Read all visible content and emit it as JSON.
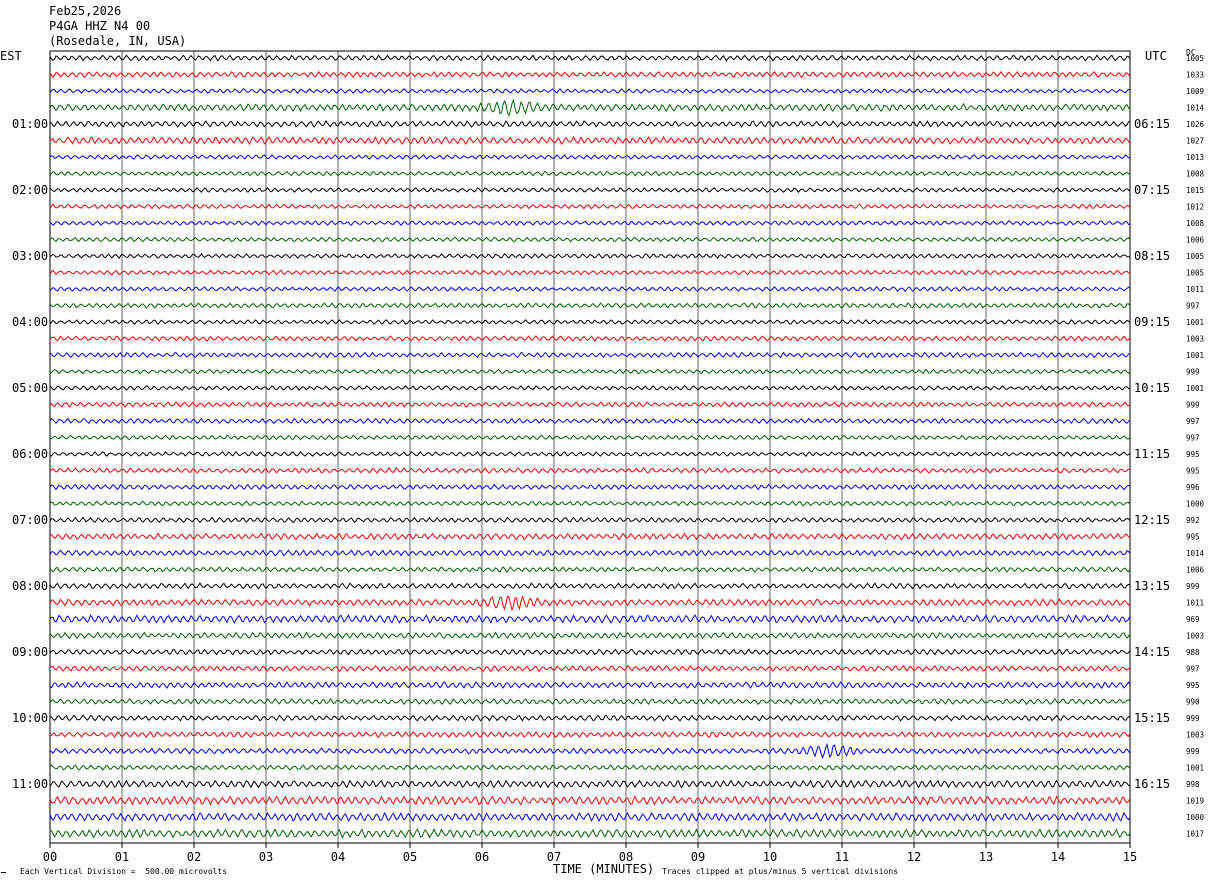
{
  "header": {
    "date": "Feb25,2026",
    "station": "P4GA HHZ N4 00",
    "location": "(Rosedale, IN, USA)"
  },
  "left_timezone": "EST",
  "right_timezone": "UTC",
  "right_col_header": "DC",
  "xaxis": {
    "label": "TIME (MINUTES)",
    "ticks": [
      "00",
      "01",
      "02",
      "03",
      "04",
      "05",
      "06",
      "07",
      "08",
      "09",
      "10",
      "11",
      "12",
      "13",
      "14",
      "15"
    ]
  },
  "footer": {
    "scale_note": "Each Vertical Division =  500.00 microvolts",
    "clip_note": "Traces clipped at plus/minus 5 vertical divisions"
  },
  "colors": [
    "#000000",
    "#ff0000",
    "#0000ff",
    "#006400"
  ],
  "chart_data": {
    "type": "helicorder",
    "title": "P4GA HHZ N4 00",
    "xlabel": "TIME (MINUTES)",
    "xlim": [
      0,
      15
    ],
    "rows_per_hour": 4,
    "left_hour_labels": [
      "01:00",
      "02:00",
      "03:00",
      "04:00",
      "05:00",
      "06:00",
      "07:00",
      "08:00",
      "09:00",
      "10:00",
      "11:00"
    ],
    "right_hour_labels": [
      "06:15",
      "07:15",
      "08:15",
      "09:15",
      "10:15",
      "11:15",
      "12:15",
      "13:15",
      "14:15",
      "15:15",
      "16:15"
    ],
    "dc_offsets": [
      1005,
      1033,
      1009,
      1014,
      1026,
      1027,
      1013,
      1008,
      1015,
      1012,
      1008,
      1006,
      1005,
      1005,
      1011,
      997,
      1001,
      1003,
      1001,
      999,
      1001,
      999,
      997,
      997,
      995,
      995,
      996,
      1000,
      992,
      995,
      1014,
      1006,
      999,
      1011,
      969,
      1003,
      988,
      997,
      995,
      990,
      999,
      1003,
      999,
      1001,
      998,
      1019,
      1000,
      1017
    ],
    "amplitude_levels": [
      2,
      2,
      1.6,
      2.6,
      2.2,
      2.6,
      1.6,
      1.6,
      1.6,
      1.6,
      1.6,
      1.6,
      1.6,
      1.6,
      1.6,
      1.8,
      1.6,
      1.8,
      1.8,
      1.6,
      1.6,
      1.8,
      1.8,
      1.6,
      1.6,
      1.8,
      1.8,
      1.6,
      1.8,
      2.2,
      2.0,
      1.8,
      2.0,
      2.4,
      2.8,
      2.2,
      2.0,
      2.0,
      2.2,
      2.0,
      2.0,
      2.0,
      2.0,
      1.8,
      2.6,
      3.0,
      3.0,
      3.0
    ],
    "events": [
      {
        "row": 3,
        "minute": 6.4,
        "note": "burst"
      },
      {
        "row": 33,
        "minute": 6.4,
        "note": "burst"
      },
      {
        "row": 42,
        "minute": 10.8,
        "note": "burst"
      }
    ],
    "grid": true
  }
}
